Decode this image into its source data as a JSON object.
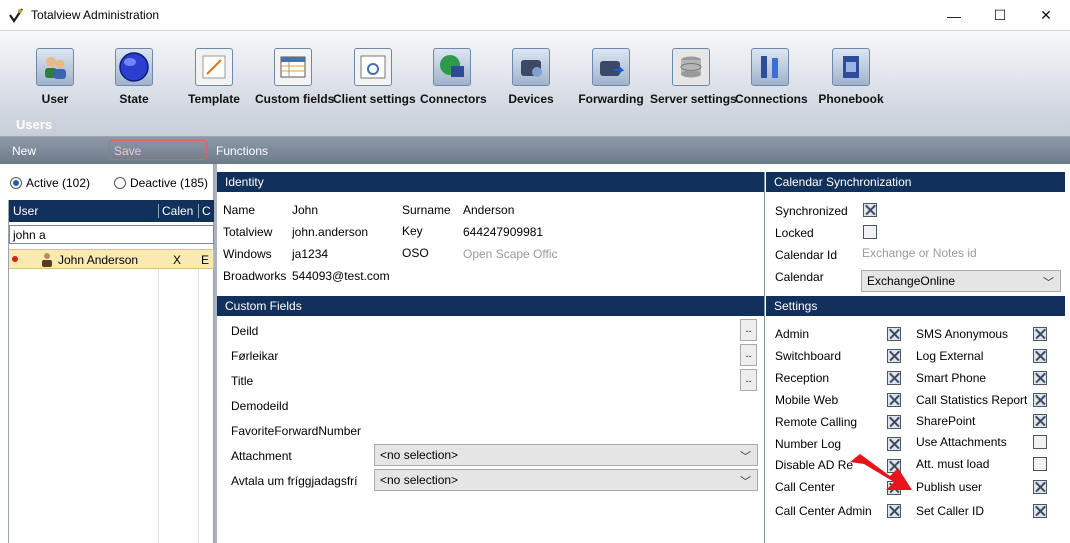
{
  "window": {
    "title": "Totalview  Administration",
    "minimize": "—",
    "maximize": "☐",
    "close": "✕"
  },
  "ribbon": {
    "buttons": [
      {
        "label": "User",
        "icon": "users-icon"
      },
      {
        "label": "State",
        "icon": "state-globe-icon"
      },
      {
        "label": "Template",
        "icon": "template-icon"
      },
      {
        "label": "Custom fields",
        "icon": "custom-fields-icon"
      },
      {
        "label": "Client settings",
        "icon": "client-settings-icon"
      },
      {
        "label": "Connectors",
        "icon": "connectors-icon"
      },
      {
        "label": "Devices",
        "icon": "devices-icon"
      },
      {
        "label": "Forwarding",
        "icon": "forwarding-icon"
      },
      {
        "label": "Server settings",
        "icon": "server-settings-icon"
      },
      {
        "label": "Connections",
        "icon": "connections-icon"
      },
      {
        "label": "Phonebook",
        "icon": "phonebook-icon"
      }
    ],
    "section": "Users"
  },
  "toolbar": {
    "new": "New",
    "save": "Save",
    "functions": "Functions"
  },
  "left": {
    "active": "Active (102)",
    "deactive": "Deactive (185)",
    "col_user": "User",
    "col_calendar": "Calen",
    "col_c": "C",
    "filter_value": "john a",
    "row": {
      "name": "John Anderson",
      "calendar": "X",
      "c": "E"
    }
  },
  "identity": {
    "header": "Identity",
    "name_label": "Name",
    "name_value": "John",
    "surname_label": "Surname",
    "surname_value": "Anderson",
    "totalview_label": "Totalview",
    "totalview_value": "john.anderson",
    "key_label": "Key",
    "key_value": "644247909981",
    "windows_label": "Windows",
    "windows_value": "ja1234",
    "oso_label": "OSO",
    "oso_placeholder": "Open Scape Offic",
    "broadworks_label": "Broadworks",
    "broadworks_value": "544093@test.com"
  },
  "calendar_sync": {
    "header": "Calendar Synchronization",
    "synchronized_label": "Synchronized",
    "synchronized": true,
    "locked_label": "Locked",
    "locked": false,
    "calendar_id_label": "Calendar Id",
    "calendar_id_placeholder": "Exchange or Notes id",
    "calendar_label": "Calendar",
    "calendar_value": "ExchangeOnline"
  },
  "custom_fields": {
    "header": "Custom Fields",
    "deild": "Deild",
    "forleikar": "Førleikar",
    "title": "Title",
    "demodeild": "Demodeild",
    "favorite": "FavoriteForwardNumber",
    "attachment_label": "Attachment",
    "attachment_value": "<no selection>",
    "avtala_label": "Avtala um fríggjadagsfrí",
    "avtala_value": "<no selection>",
    "ellipsis": ".."
  },
  "settings": {
    "header": "Settings",
    "left": [
      {
        "label": "Admin",
        "checked": true
      },
      {
        "label": "Switchboard",
        "checked": true
      },
      {
        "label": "Reception",
        "checked": true
      },
      {
        "label": "Mobile Web",
        "checked": true
      },
      {
        "label": "Remote Calling",
        "checked": true
      },
      {
        "label": "Number Log",
        "checked": true
      },
      {
        "label": "Disable AD Re",
        "checked": true
      },
      {
        "label": "Call Center",
        "checked": true
      },
      {
        "label": "Call Center Admin",
        "checked": true
      }
    ],
    "right": [
      {
        "label": "SMS Anonymous",
        "checked": true
      },
      {
        "label": "Log External",
        "checked": true
      },
      {
        "label": "Smart Phone",
        "checked": true
      },
      {
        "label": "Call Statistics Report",
        "checked": true
      },
      {
        "label": "SharePoint",
        "checked": true
      },
      {
        "label": "Use Attachments",
        "checked": false
      },
      {
        "label": "Att. must load",
        "checked": false
      },
      {
        "label": "Publish user",
        "checked": true
      },
      {
        "label": "Set Caller ID",
        "checked": true
      }
    ]
  },
  "colors": {
    "header_navy": "#12305c",
    "arrow_red": "#e8141b",
    "row_highlight": "#fbe9b3"
  }
}
